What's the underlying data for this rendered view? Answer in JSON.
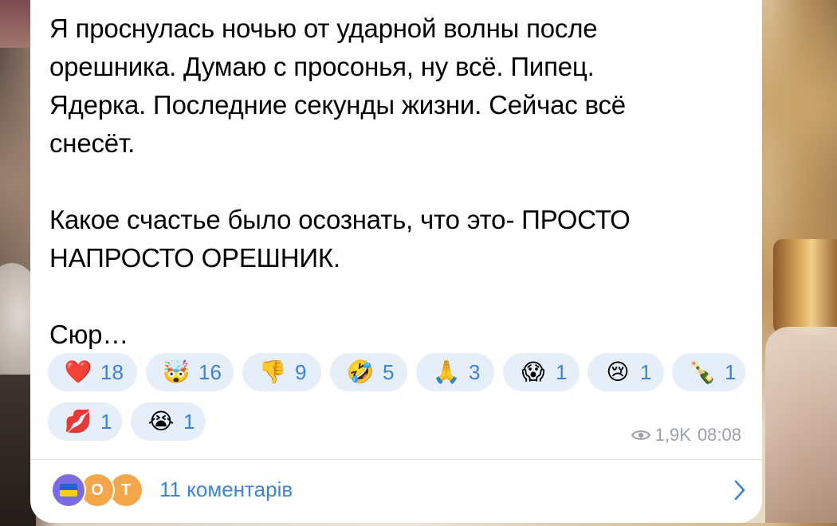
{
  "message": {
    "text": "Я проснулась ночью от ударной волны после\nорешника. Думаю с просонья, ну всё. Пипец.\nЯдерка. Последние секунды жизни. Сейчас всё\nснесёт.\n\nКакое счастье было осознать, что это- ПРОСТО\nНАПРОСТО ОРЕШНИК.\n\nСюр…"
  },
  "reactions": [
    {
      "emoji": "❤️",
      "icon": "red-heart-icon",
      "count": "18"
    },
    {
      "emoji": "🤯",
      "icon": "exploding-head-icon",
      "count": "16"
    },
    {
      "emoji": "👎",
      "icon": "thumbs-down-icon",
      "count": "9"
    },
    {
      "emoji": "🤣",
      "icon": "rolling-laughing-icon",
      "count": "5"
    },
    {
      "emoji": "🙏",
      "icon": "folded-hands-icon",
      "count": "3"
    },
    {
      "emoji": "😱",
      "icon": "screaming-face-icon",
      "count": "1"
    },
    {
      "emoji": "😢",
      "icon": "crying-face-icon",
      "count": "1"
    },
    {
      "emoji": "🍾",
      "icon": "champagne-bottle-icon",
      "count": "1"
    },
    {
      "emoji": "💋",
      "icon": "kiss-mark-icon",
      "count": "1"
    },
    {
      "emoji": "😭",
      "icon": "loudly-crying-face-icon",
      "count": "1"
    }
  ],
  "meta": {
    "views": "1,9K",
    "time": "08:08"
  },
  "comments": {
    "label": "11 коментарів",
    "avatars": [
      {
        "type": "flag",
        "icon": "ukraine-flag-icon"
      },
      {
        "type": "letter",
        "letter": "О"
      },
      {
        "type": "letter",
        "letter": "Т"
      }
    ]
  },
  "colors": {
    "accent": "#3b84d8",
    "reaction_bg": "#e6eefa",
    "meta_text": "#9aa0a6",
    "avatar_orange": "#f4a64a",
    "avatar_purple": "#7b6be0"
  }
}
